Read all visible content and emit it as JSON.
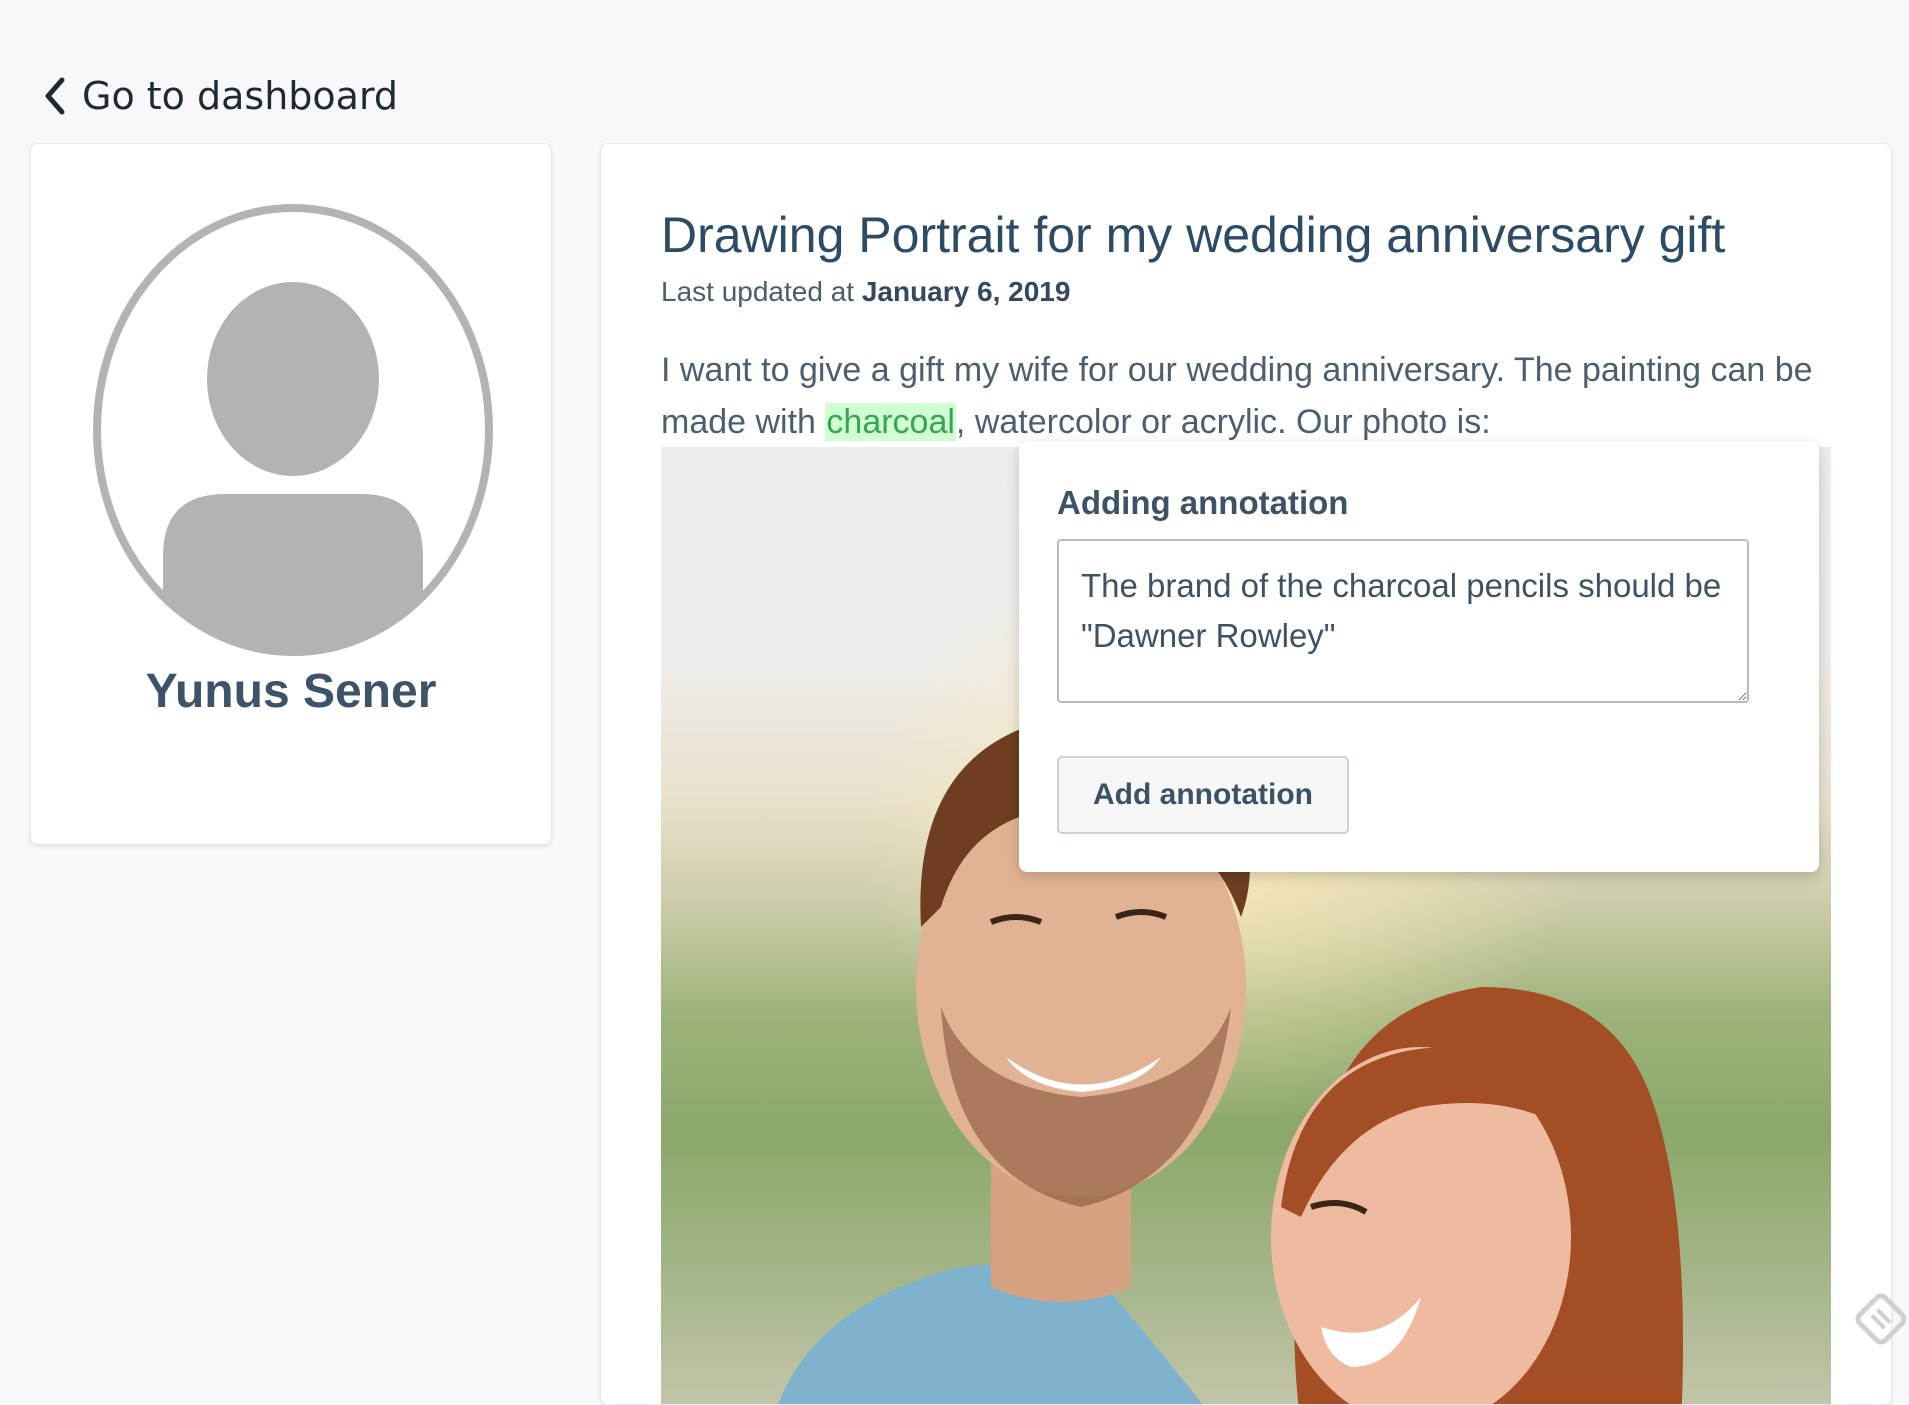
{
  "nav": {
    "back_label": "Go to dashboard"
  },
  "profile": {
    "name": "Yunus Sener"
  },
  "post": {
    "title": "Drawing Portrait for my wedding anniversary gift",
    "updated_prefix": "Last updated at",
    "updated_date": "January 6, 2019",
    "body_before": "I want to give a gift my wife for our wedding anniversary. The painting can be made with ",
    "body_highlight": "charcoal",
    "body_after": ", watercolor or acrylic. Our photo is:"
  },
  "annotation_popup": {
    "title": "Adding annotation",
    "input_value": "The brand of the charcoal pencils should be \"Dawner Rowley\"",
    "submit_label": "Add annotation"
  },
  "colors": {
    "heading": "#2c4b66",
    "highlight_bg": "#cfffd0",
    "highlight_text": "#3aa35a",
    "avatar_gray": "#b3b3b3"
  },
  "icons": [
    "chevron-left-icon",
    "avatar-icon",
    "corner-badge-icon"
  ]
}
